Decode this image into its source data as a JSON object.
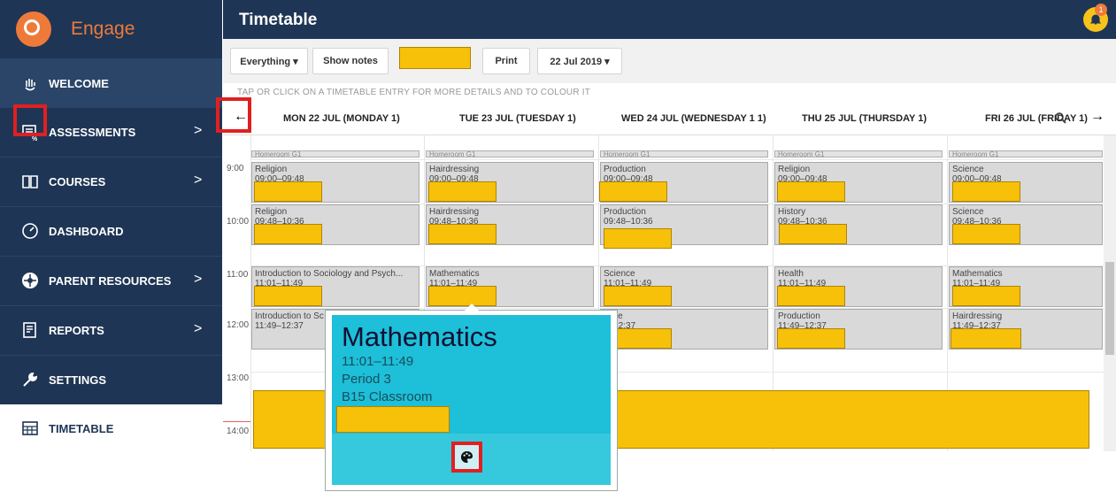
{
  "brand": {
    "name": "Engage"
  },
  "sidebar": {
    "items": [
      {
        "label": "WELCOME",
        "icon": "hand-wave-icon",
        "chevron": ""
      },
      {
        "label": "ASSESSMENTS",
        "icon": "assessment-icon",
        "chevron": ">"
      },
      {
        "label": "COURSES",
        "icon": "book-icon",
        "chevron": ">"
      },
      {
        "label": "DASHBOARD",
        "icon": "gauge-icon",
        "chevron": ""
      },
      {
        "label": "PARENT RESOURCES",
        "icon": "sunburst-icon",
        "chevron": ">"
      },
      {
        "label": "REPORTS",
        "icon": "report-icon",
        "chevron": ">"
      },
      {
        "label": "SETTINGS",
        "icon": "wrench-icon",
        "chevron": ""
      },
      {
        "label": "TIMETABLE",
        "icon": "calendar-grid-icon",
        "chevron": ""
      }
    ]
  },
  "header": {
    "title": "Timetable",
    "notification_count": "1"
  },
  "toolbar": {
    "filter_label": "Everything ▾",
    "notes_label": "Show notes",
    "print_label": "Print",
    "date_label": "22 Jul 2019 ▾"
  },
  "hint": "TAP OR CLICK ON A TIMETABLE ENTRY FOR MORE DETAILS AND TO COLOUR IT",
  "nav": {
    "prev": "←",
    "next": "→"
  },
  "days": [
    "MON 22 JUL (MONDAY 1)",
    "TUE 23 JUL (TUESDAY 1)",
    "WED 24 JUL (WEDNESDAY 1 1)",
    "THU 25 JUL (THURSDAY 1)",
    "FRI 26 JUL (FRIDAY 1)"
  ],
  "times": [
    "9:00",
    "10:00",
    "11:00",
    "12:00",
    "13:00",
    "14:00"
  ],
  "homeroom": "Homeroom G1",
  "entries": {
    "mon": [
      {
        "subject": "Religion",
        "time": "09:00–09:48"
      },
      {
        "subject": "Religion",
        "time": "09:48–10:36"
      },
      {
        "subject": "Introduction to Sociology and Psych...",
        "time": "11:01–11:49"
      },
      {
        "subject": "Introduction to Sc",
        "time": "11:49–12:37"
      }
    ],
    "tue": [
      {
        "subject": "Hairdressing",
        "time": "09:00–09:48"
      },
      {
        "subject": "Hairdressing",
        "time": "09:48–10:36"
      },
      {
        "subject": "Mathematics",
        "time": "11:01–11:49"
      }
    ],
    "wed": [
      {
        "subject": "Production",
        "time": "09:00–09:48"
      },
      {
        "subject": "Production",
        "time": "09:48–10:36"
      },
      {
        "subject": "Science",
        "time": "11:01–11:49"
      },
      {
        "subject": "ence",
        "time": "9–12:37"
      }
    ],
    "thu": [
      {
        "subject": "Religion",
        "time": "09:00–09:48"
      },
      {
        "subject": "History",
        "time": "09:48–10:36"
      },
      {
        "subject": "Health",
        "time": "11:01–11:49"
      },
      {
        "subject": "Production",
        "time": "11:49–12:37"
      }
    ],
    "fri": [
      {
        "subject": "Science",
        "time": "09:00–09:48"
      },
      {
        "subject": "Science",
        "time": "09:48–10:36"
      },
      {
        "subject": "Mathematics",
        "time": "11:01–11:49"
      },
      {
        "subject": "Hairdressing",
        "time": "11:49–12:37"
      }
    ]
  },
  "popup": {
    "subject": "Mathematics",
    "time": "11:01–11:49",
    "period": "Period 3",
    "room": "B15 Classroom",
    "action_icon": "palette-icon"
  },
  "colors": {
    "navy": "#1e3555",
    "accent": "#ee7a3a",
    "redaction": "#f6c108",
    "popup": "#1ebfd8",
    "highlight": "#e02020"
  }
}
